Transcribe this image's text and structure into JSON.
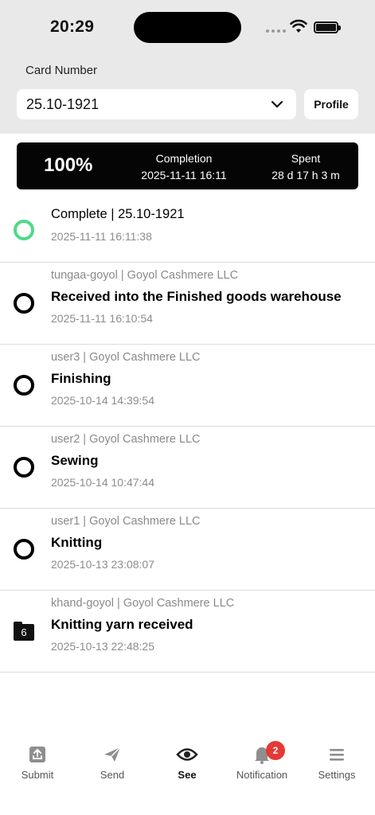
{
  "status_bar": {
    "time": "20:29"
  },
  "header": {
    "card_label": "Card Number",
    "card_value": "25.10-1921",
    "profile_label": "Profile"
  },
  "summary": {
    "percent": "100%",
    "completion_label": "Completion",
    "completion_value": "2025-11-11 16:11",
    "spent_label": "Spent",
    "spent_value": "28 d 17 h 3 m"
  },
  "timeline": [
    {
      "meta": "",
      "title": "Complete | 25.10-1921",
      "timestamp": "2025-11-11 16:11:38",
      "icon": "check-circle"
    },
    {
      "meta": "tungaa-goyol | Goyol Cashmere LLC",
      "title": "Received into the Finished goods warehouse",
      "timestamp": "2025-11-11 16:10:54",
      "icon": "circle"
    },
    {
      "meta": "user3 | Goyol Cashmere LLC",
      "title": "Finishing",
      "timestamp": "2025-10-14 14:39:54",
      "icon": "circle"
    },
    {
      "meta": "user2 | Goyol Cashmere LLC",
      "title": "Sewing",
      "timestamp": "2025-10-14 10:47:44",
      "icon": "circle"
    },
    {
      "meta": "user1 | Goyol Cashmere LLC",
      "title": "Knitting",
      "timestamp": "2025-10-13 23:08:07",
      "icon": "circle"
    },
    {
      "meta": "khand-goyol | Goyol Cashmere LLC",
      "title": "Knitting yarn received",
      "timestamp": "2025-10-13 22:48:25",
      "icon": "folder",
      "icon_text": "6"
    }
  ],
  "tabs": [
    {
      "label": "Submit",
      "icon": "upload-icon"
    },
    {
      "label": "Send",
      "icon": "send-icon"
    },
    {
      "label": "See",
      "icon": "eye-icon",
      "active": true
    },
    {
      "label": "Notification",
      "icon": "bell-icon",
      "badge": "2"
    },
    {
      "label": "Settings",
      "icon": "menu-icon"
    }
  ],
  "colors": {
    "complete_ring": "#4fd98a",
    "badge": "#e53935",
    "summary_bg": "#050505"
  }
}
